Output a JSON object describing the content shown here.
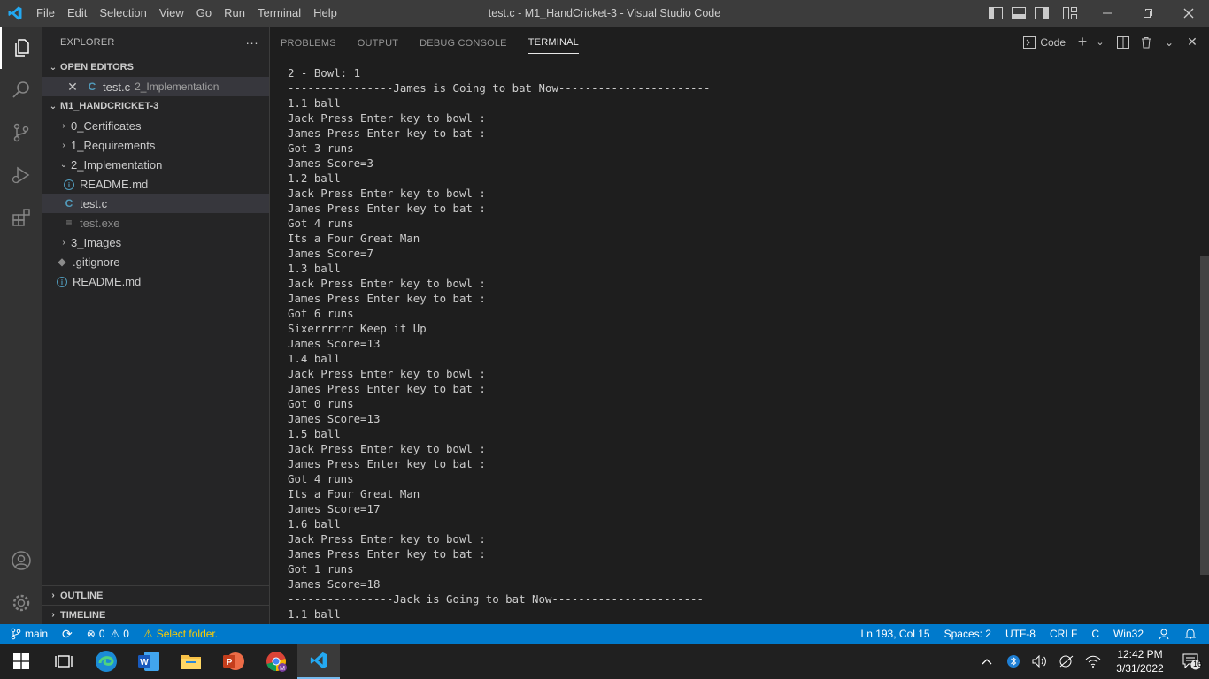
{
  "window": {
    "title": "test.c - M1_HandCricket-3 - Visual Studio Code",
    "menu": [
      "File",
      "Edit",
      "Selection",
      "View",
      "Go",
      "Run",
      "Terminal",
      "Help"
    ]
  },
  "activity_bar": {
    "top": [
      "files-icon",
      "search-icon",
      "source-control-icon",
      "run-debug-icon",
      "extensions-icon"
    ],
    "bottom": [
      "account-icon",
      "settings-gear-icon"
    ]
  },
  "sidebar": {
    "title": "EXPLORER",
    "more": "···",
    "open_editors": {
      "header": "OPEN EDITORS",
      "items": [
        {
          "icon": "C",
          "name": "test.c",
          "desc": "2_Implementation"
        }
      ]
    },
    "workspace": {
      "header": "M1_HANDCRICKET-3",
      "items": [
        {
          "name": "0_Certificates"
        },
        {
          "name": "1_Requirements"
        },
        {
          "name": "2_Implementation"
        },
        {
          "name": "README.md"
        },
        {
          "name": "test.c"
        },
        {
          "name": "test.exe"
        },
        {
          "name": "3_Images"
        },
        {
          "name": ".gitignore"
        },
        {
          "name": "README.md"
        }
      ]
    },
    "outline": "OUTLINE",
    "timeline": "TIMELINE"
  },
  "panel": {
    "tabs": [
      "PROBLEMS",
      "OUTPUT",
      "DEBUG CONSOLE",
      "TERMINAL"
    ],
    "active_tab": "TERMINAL",
    "terminal_name": "Code",
    "terminal_lines": [
      "2 - Bowl: 1",
      "----------------James is Going to bat Now-----------------------",
      "1.1 ball",
      "Jack Press Enter key to bowl :",
      "James Press Enter key to bat :",
      "Got 3 runs",
      "James Score=3",
      "1.2 ball",
      "Jack Press Enter key to bowl :",
      "James Press Enter key to bat :",
      "Got 4 runs",
      "Its a Four Great Man",
      "James Score=7",
      "1.3 ball",
      "Jack Press Enter key to bowl :",
      "James Press Enter key to bat :",
      "Got 6 runs",
      "Sixerrrrrr Keep it Up",
      "James Score=13",
      "1.4 ball",
      "Jack Press Enter key to bowl :",
      "James Press Enter key to bat :",
      "Got 0 runs",
      "James Score=13",
      "1.5 ball",
      "Jack Press Enter key to bowl :",
      "James Press Enter key to bat :",
      "Got 4 runs",
      "Its a Four Great Man",
      "James Score=17",
      "1.6 ball",
      "Jack Press Enter key to bowl :",
      "James Press Enter key to bat :",
      "Got 1 runs",
      "James Score=18",
      "----------------Jack is Going to bat Now-----------------------",
      "1.1 ball"
    ]
  },
  "status_bar": {
    "branch": "main",
    "errors": "0",
    "warnings": "0",
    "notice": "Select folder.",
    "position": "Ln 193, Col 15",
    "spaces": "Spaces: 2",
    "encoding": "UTF-8",
    "eol": "CRLF",
    "language": "C",
    "platform": "Win32"
  },
  "taskbar": {
    "apps": [
      "windows-start-icon",
      "task-view-icon",
      "edge-icon",
      "word-icon",
      "file-explorer-icon",
      "powerpoint-icon",
      "chrome-icon",
      "vscode-icon"
    ],
    "time": "12:42 PM",
    "date": "3/31/2022",
    "notifications": "16"
  },
  "colors": {
    "titlebar": "#3c3c3c",
    "activitybar": "#333333",
    "sidebar": "#252526",
    "editor": "#1e1e1e",
    "statusbar": "#007acc",
    "taskbar": "#202020",
    "c_file": "#519aba",
    "warning": "#ffcc00"
  }
}
